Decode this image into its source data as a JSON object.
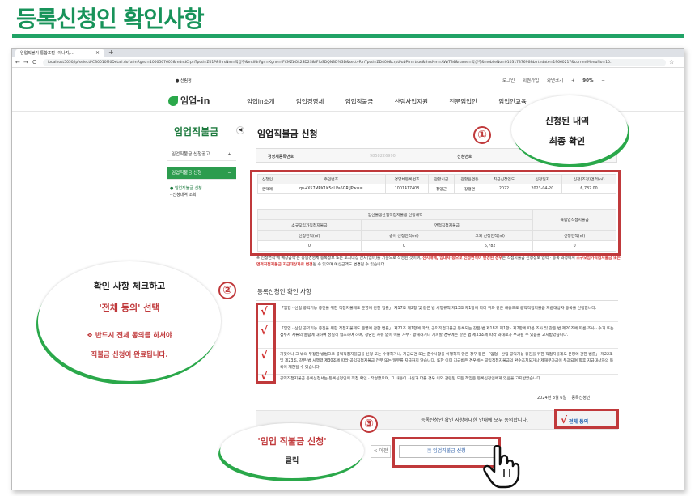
{
  "heading": "등록신청인 확인사항",
  "browser": {
    "tab_title": "임업직불기 통합포털 (아나지/...",
    "tab_close": "×",
    "new_tab": "+",
    "nav_back": "←",
    "nav_forward": "→",
    "nav_reload": "C",
    "url": "localhost5050/ip/selectPCB0010MöDetail.do?afmRgno=1000567605&mdndCrpnTpcd=Z01P&fhrsNm=박상주&mdfdrFgn=Kgno=tFCMZbOL2SD2S&tFfbSDQN3D%3D&sectvRlnTpcd=ZD400&crptPubPtn=true&fhrsNm=AW/T34&name=박상주&mobileNo=01031737696&birthdate=19660217&currentMenuNo=10..",
    "star": "☆"
  },
  "util": {
    "gov_logo": "산림청",
    "login": "로그인",
    "join": "회원가입",
    "zoom_label": "화면크기",
    "zoom_plus": "+",
    "zoom_value": "90%",
    "zoom_minus": "−"
  },
  "header": {
    "logo": "임업-in",
    "nav": [
      "임업in소개",
      "임업경영체",
      "임업직불금",
      "산림사업지원",
      "전문임업인",
      "임업인교육"
    ]
  },
  "sidebar": {
    "title": "임업직불금",
    "toggle": "◀",
    "items": [
      {
        "label": "임업직불금 신청공고",
        "icon": "+"
      },
      {
        "label": "임업직불금 신청",
        "icon": "−"
      }
    ],
    "sub": [
      "● 임업직불금 신청",
      "- 신청내역 조회"
    ]
  },
  "main": {
    "title": "임업직불금 신청",
    "reg_no_label": "경영체등록번호",
    "reg_no_value": "9858226990",
    "apply_label": "신청번호"
  },
  "table1": {
    "headers": [
      "신청인",
      "주민번호",
      "경영체등록번호",
      "관할시군",
      "관할읍면동",
      "최근신청연도",
      "신청일자",
      "신청(조정)면적(㎡)"
    ],
    "row": [
      "권택례",
      "qn+X57MRK1K5qLPa5GR JPw==",
      "1001417408",
      "청양군",
      "장평면",
      "2022",
      "2023-04-20",
      "6,782.00"
    ]
  },
  "table2": {
    "group_header": "임산물생산업직접지불금 신청내역",
    "small_header": "소규모임가직접지불금",
    "area_header": "면적직접지불금",
    "right_header": "육림업직접지불금",
    "cols": [
      "신청면적(㎡)",
      "송이 신청면적(㎡)",
      "그외 신청면적(㎡)",
      "신청면적(㎡)"
    ],
    "values": [
      "0",
      "0",
      "6,782",
      "0"
    ]
  },
  "notice": {
    "part1": "※ 신청면적'에 예상금액'은 농업경영체 등록정보 또는 토지대장 산지(임야)를 기준으로 작성된 것이며, ",
    "part2": "산지매매, 임대차 등으로 신청면적이 변경된 경우",
    "part3": "는 직접지불금 신청정보 입력 · 등록 과정에서 ",
    "part4": "소규모임가직접지불금 또는 면적직접지불금 지급대상자로 변경",
    "part5": "될 수 있으며 예상금액도 변경될 수 있습니다."
  },
  "consent": {
    "title": "등록신청인 확인 사항",
    "items": [
      "「임업 · 산림 공익기능 증진을 위한 직접지불제도 운영에 관한 법률」 제17조 제2항 및 같은 법 시행규칙 제13조 제1항에 따라 위와 같은 내용으로 공익직접지불금 지급대상자 등록을 신청합니다.",
      "「임업 · 산림 공익기능 증진을 위한 직접지불제도 운영에 관한 법률」 제21조 제1항에 따라, 공익직접지불금 등록되는 같은 법 제18조 제1항 · 제2항에 따른 조사 및 같은 법 제20조에 따른 조사 · 수거 또는 점부서 서류의 열람에 대하여 성실히 협조하여 하며, 정당한 사유 없이 이를 거부 · 방해하거나 기피할 경우에는 같은 법 제33조에 따라 과태료가 부과될 수 있음을 고지받았습니다.",
      "거짓이나 그 밖의 부정한 방법으로 공익직접지불금을 신청 또는 수령하거나, 지급요건 또는 준수사항을 이행하지 않은 경우 등은 「임업 · 산림 공익기능 증진을 위한 직접지불제도 운영에 관한 법률」 제22조 및 제23조, 같은 법 시행령 제30조에 따라 공익직접지불금 전부 또는 일부를 지급하지 않습니다. 또한 이미 지급받은 경우에는 공익직접지불금의 환수조치되거나 제재부가금이 부과되며 향후 지급대상자의 등록이 제한될 수 있습니다.",
      "공익직접지불금 등록신청서는 등록신청인이 직접 확인 · 작성했으며, 그 내용이 사실과 다를 경우 이와 관련된 모든 책임은 등록신청인에게 있음을 고지받았습니다."
    ],
    "check": "√",
    "date": "2024년 3월 6일",
    "signer": "등록신청인",
    "agree_text": "등록신청인 확인 사항에대한 안내에 모두 동의합니다.",
    "all_agree": "전체 동의",
    "back_button": "< 이전",
    "apply_button": "임업직불금 신청"
  },
  "annotations": {
    "num1": "①",
    "num2": "②",
    "num3": "③",
    "callout1_line1": "신청된 내역",
    "callout1_line2": "최종 확인",
    "callout2_line1": "확인 사항 체크하고",
    "callout2_line2": "'전체 동의' 선택",
    "callout2_line3": "❖ 반드시 전체 동의를 하셔야",
    "callout2_line4": "직불금 신청이 완료됩니다.",
    "callout3_line1": "'임업 직불금 신청'",
    "callout3_line2": "클릭"
  },
  "colors": {
    "brand_green": "#21a366",
    "highlight_red": "#c0393b"
  }
}
